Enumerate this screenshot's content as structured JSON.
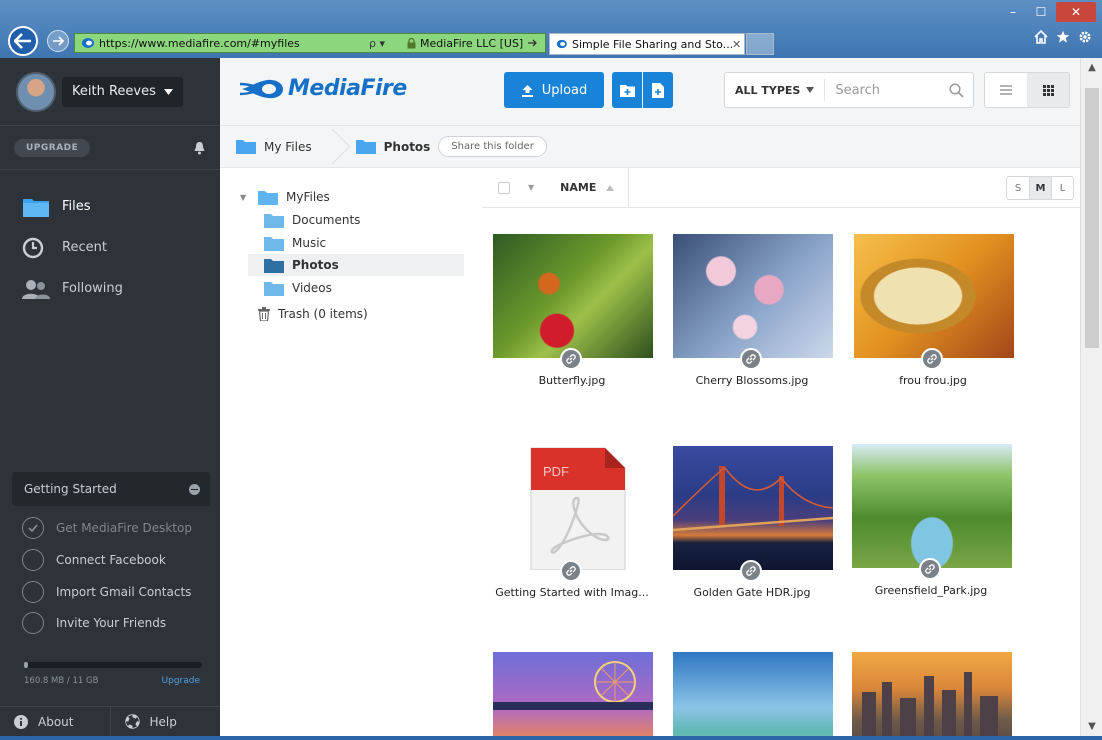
{
  "browser": {
    "url": "https://www.mediafire.com/#myfiles",
    "search_ctrl": "ρ ▾",
    "cert": "MediaFire LLC [US]",
    "tab_title": "Simple File Sharing and Sto...",
    "tab_close": "✕",
    "window_controls": {
      "minimize": "–",
      "maximize": "☐",
      "close": "✕"
    }
  },
  "sidebar": {
    "user_name": "Keith Reeves",
    "upgrade_label": "UPGRADE",
    "nav": [
      {
        "label": "Files",
        "icon": "folder-icon",
        "active": true
      },
      {
        "label": "Recent",
        "icon": "clock-icon",
        "active": false
      },
      {
        "label": "Following",
        "icon": "people-icon",
        "active": false
      }
    ],
    "getting_started": {
      "title": "Getting Started",
      "items": [
        {
          "label": "Get MediaFire Desktop",
          "done": true
        },
        {
          "label": "Connect Facebook",
          "done": false
        },
        {
          "label": "Import Gmail Contacts",
          "done": false
        },
        {
          "label": "Invite Your Friends",
          "done": false
        }
      ]
    },
    "storage": {
      "text": "160.8 MB / 11 GB",
      "fraction": 0.015,
      "upgrade_link": "Upgrade"
    },
    "footer": {
      "about": "About",
      "help": "Help"
    }
  },
  "topbar": {
    "brand": "MediaFire",
    "upload_label": "Upload",
    "types_label": "ALL TYPES",
    "search_placeholder": "Search"
  },
  "breadcrumb": {
    "root": "My Files",
    "current": "Photos",
    "share_label": "Share this folder"
  },
  "tree": {
    "root": "MyFiles",
    "children": [
      "Documents",
      "Music",
      "Photos",
      "Videos"
    ],
    "selected": "Photos",
    "trash": "Trash (0 items)"
  },
  "grid": {
    "name_header": "NAME",
    "sizes": [
      "S",
      "M",
      "L"
    ],
    "selected_size": "M",
    "files": [
      {
        "name": "Butterfly.jpg",
        "thumb": "butterfly"
      },
      {
        "name": "Cherry Blossoms.jpg",
        "thumb": "cherry"
      },
      {
        "name": "frou frou.jpg",
        "thumb": "coffee"
      },
      {
        "name": "Getting Started with Imag...",
        "thumb": "pdf"
      },
      {
        "name": "Golden Gate HDR.jpg",
        "thumb": "gg"
      },
      {
        "name": "Greensfield_Park.jpg",
        "thumb": "park"
      },
      {
        "name": "",
        "thumb": "sf"
      },
      {
        "name": "",
        "thumb": "beach"
      },
      {
        "name": "",
        "thumb": "city"
      }
    ]
  },
  "colors": {
    "accent": "#1883d7",
    "sidebar_bg": "#2d3339",
    "address_secure": "#8cd67e",
    "close_button": "#c9463d"
  }
}
